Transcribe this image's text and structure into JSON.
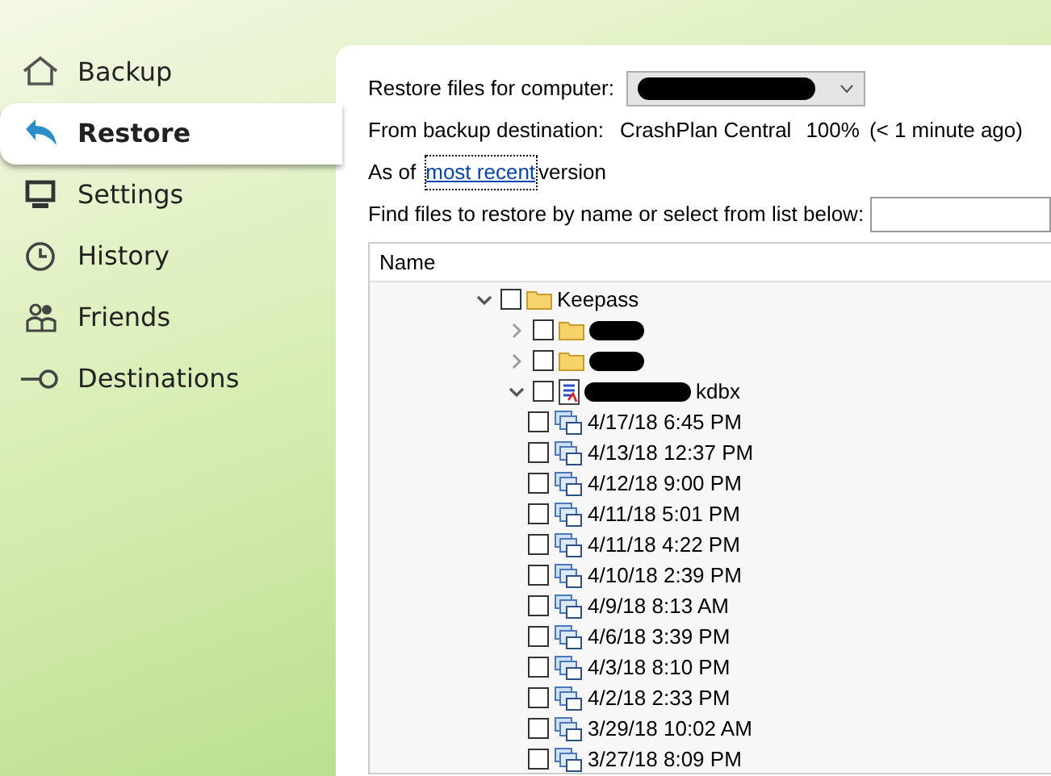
{
  "sidebar": {
    "items": [
      {
        "label": "Backup",
        "selected": false
      },
      {
        "label": "Restore",
        "selected": true
      },
      {
        "label": "Settings",
        "selected": false
      },
      {
        "label": "History",
        "selected": false
      },
      {
        "label": "Friends",
        "selected": false
      },
      {
        "label": "Destinations",
        "selected": false
      }
    ]
  },
  "restore": {
    "computer_label": "Restore files for computer:",
    "computer_select": {
      "redacted": true
    },
    "destination_label": "From backup destination:",
    "destination": "CrashPlan Central",
    "percent": "100%",
    "last_backup": "(< 1 minute ago)",
    "as_of": "As of",
    "version_link": "most recent",
    "version_suffix": "version",
    "find_label": "Find files to restore by name or select from list below:"
  },
  "tree": {
    "columns": [
      "Name"
    ],
    "items": [
      {
        "kind": "folder",
        "label": "Keepass",
        "expanded": true,
        "checked": false,
        "children": [
          {
            "kind": "folder",
            "redacted": true,
            "expanded": false,
            "checked": false
          },
          {
            "kind": "folder",
            "redacted": true,
            "expanded": false,
            "checked": false
          },
          {
            "kind": "file",
            "redacted": true,
            "label": "kdbx",
            "expanded": true,
            "checked": false,
            "children": [
              {
                "kind": "version",
                "label": "4/17/18 6:45 PM",
                "checked": false
              },
              {
                "kind": "version",
                "label": "4/13/18 12:37 PM",
                "checked": false
              },
              {
                "kind": "version",
                "label": "4/12/18 9:00 PM",
                "checked": false
              },
              {
                "kind": "version",
                "label": "4/11/18 5:01 PM",
                "checked": false
              },
              {
                "kind": "version",
                "label": "4/11/18 4:22 PM",
                "checked": false
              },
              {
                "kind": "version",
                "label": "4/10/18 2:39 PM",
                "checked": false
              },
              {
                "kind": "version",
                "label": "4/9/18 8:13 AM",
                "checked": false
              },
              {
                "kind": "version",
                "label": "4/6/18 3:39 PM",
                "checked": false
              },
              {
                "kind": "version",
                "label": "4/3/18 8:10 PM",
                "checked": false
              },
              {
                "kind": "version",
                "label": "4/2/18 2:33 PM",
                "checked": false
              },
              {
                "kind": "version",
                "label": "3/29/18 10:02 AM",
                "checked": false
              },
              {
                "kind": "version",
                "label": "3/27/18 8:09 PM",
                "checked": false
              }
            ]
          }
        ]
      }
    ]
  }
}
